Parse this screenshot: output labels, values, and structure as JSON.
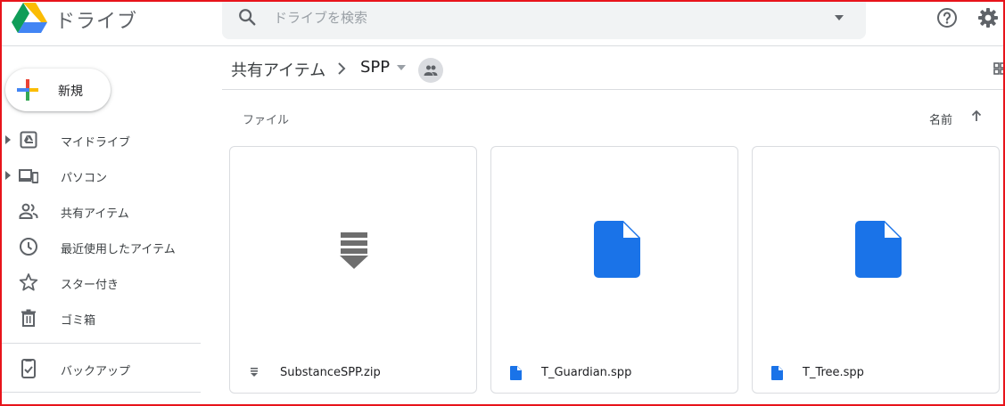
{
  "app": {
    "title": "ドライブ"
  },
  "search": {
    "placeholder": "ドライブを検索"
  },
  "sidebar": {
    "new_label": "新規",
    "items": [
      {
        "label": "マイドライブ"
      },
      {
        "label": "パソコン"
      },
      {
        "label": "共有アイテム"
      },
      {
        "label": "最近使用したアイテム"
      },
      {
        "label": "スター付き"
      },
      {
        "label": "ゴミ箱"
      },
      {
        "label": "バックアップ"
      }
    ]
  },
  "breadcrumb": {
    "root": "共有アイテム",
    "current": "SPP"
  },
  "main": {
    "section_label": "ファイル",
    "sort_label": "名前",
    "files": [
      {
        "name": "SubstanceSPP.zip",
        "icon": "zip-icon"
      },
      {
        "name": "T_Guardian.spp",
        "icon": "file-icon"
      },
      {
        "name": "T_Tree.spp",
        "icon": "file-icon"
      }
    ]
  },
  "colors": {
    "accent_blue": "#1a73e8",
    "frame_red": "#e8141b"
  }
}
